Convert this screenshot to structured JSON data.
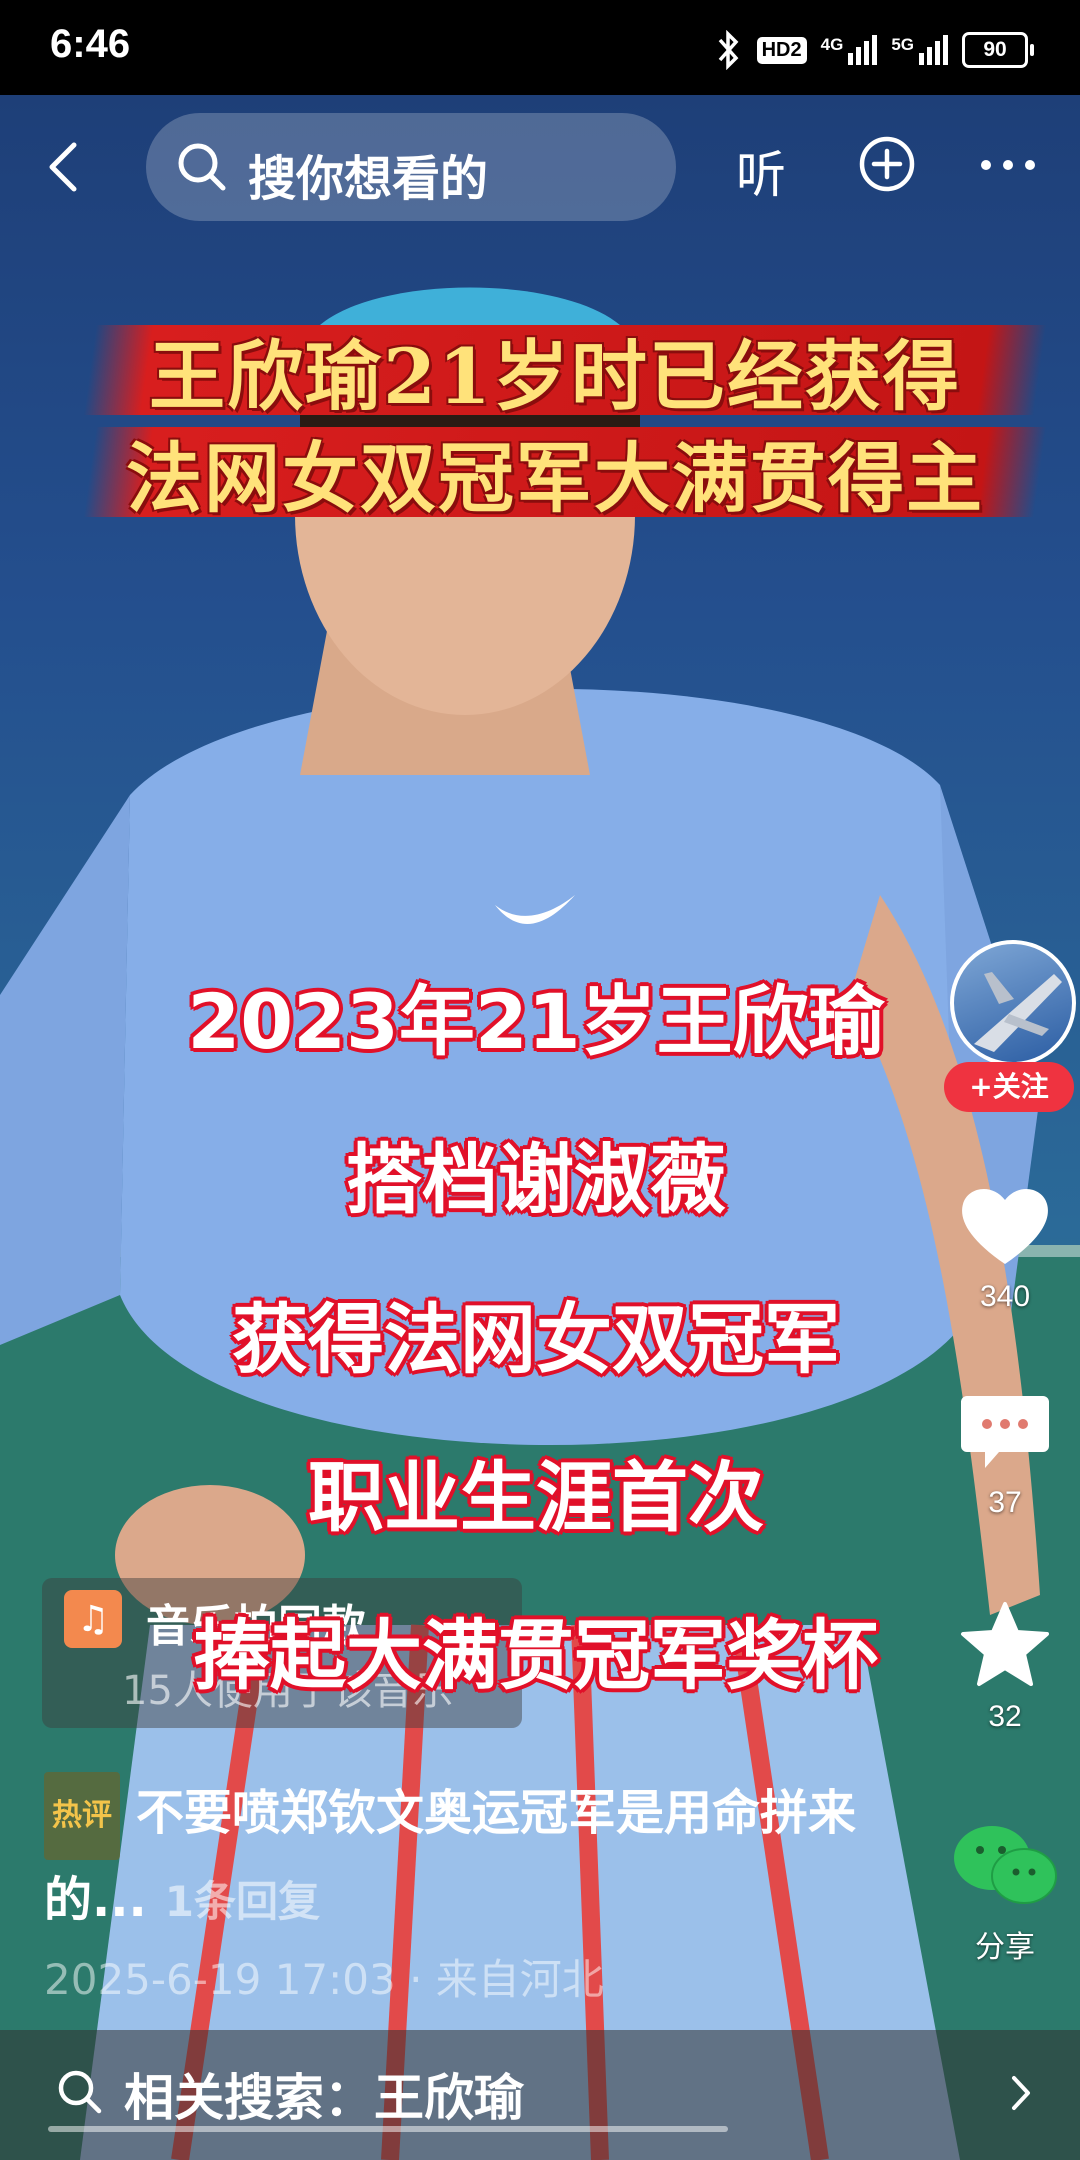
{
  "status_bar": {
    "time": "6:46",
    "hd_label": "HD2",
    "network_1": "4G",
    "network_2": "5G",
    "battery": "90"
  },
  "top_nav": {
    "search_placeholder": "搜你想看的",
    "listen_label": "听"
  },
  "video": {
    "title_lines": [
      "王欣瑜21岁时已经获得",
      "法网女双冠军大满贯得主"
    ],
    "subtitle_lines": [
      "2023年21岁王欣瑜",
      "搭档谢淑薇",
      "获得法网女双冠军",
      "职业生涯首次",
      "捧起大满贯冠军奖杯"
    ]
  },
  "rail": {
    "follow_label": "+关注",
    "like_count": "340",
    "comment_count": "37",
    "favorite_count": "32",
    "share_label": "分享"
  },
  "music": {
    "title": "音乐拍同款",
    "subtitle": "15人使用了该音乐"
  },
  "hot_comment": {
    "badge": "热评",
    "text": "不要喷郑钦文奥运冠军是用命拼来的...",
    "reply": "1条回复",
    "meta": "2025-6-19 17:03 · 来自河北"
  },
  "related_search": {
    "text": "相关搜索：王欣瑜"
  },
  "colors": {
    "follow_red": "#ef3340",
    "subtitle_outline": "#e1112a",
    "banner_gold": "#ffe27a",
    "music_orange": "#f3894e",
    "hot_badge_gold": "#f3c44a"
  }
}
